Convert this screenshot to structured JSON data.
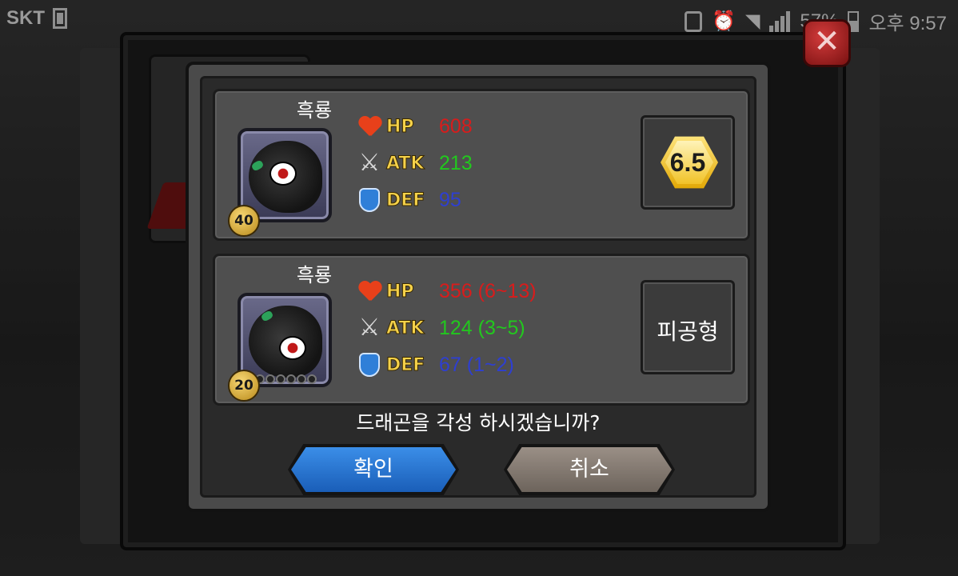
{
  "status_bar": {
    "carrier": "SKT",
    "battery": "57%",
    "time": "오후 9:57"
  },
  "dialog": {
    "current": {
      "name": "흑룡",
      "level": "40",
      "stats": {
        "hp_label": "HP",
        "hp_value": "608",
        "atk_label": "ATK",
        "atk_value": "213",
        "def_label": "DEF",
        "def_value": "95"
      },
      "grade": "6.5"
    },
    "awakened": {
      "name": "흑룡",
      "level": "20",
      "stars_filled": 0,
      "stats": {
        "hp_label": "HP",
        "hp_value": "356 (6~13)",
        "atk_label": "ATK",
        "atk_value": "124 (3~5)",
        "def_label": "DEF",
        "def_value": "67 (1~2)"
      },
      "type": "피공형"
    },
    "question": "드래곤을 각성 하시겠습니까?",
    "confirm_label": "확인",
    "cancel_label": "취소"
  },
  "colors": {
    "hp": "#d81c1c",
    "atk": "#22c81e",
    "def": "#2e3fd1",
    "confirm_button": "#2a76d0",
    "cancel_button": "#8a7f76"
  }
}
